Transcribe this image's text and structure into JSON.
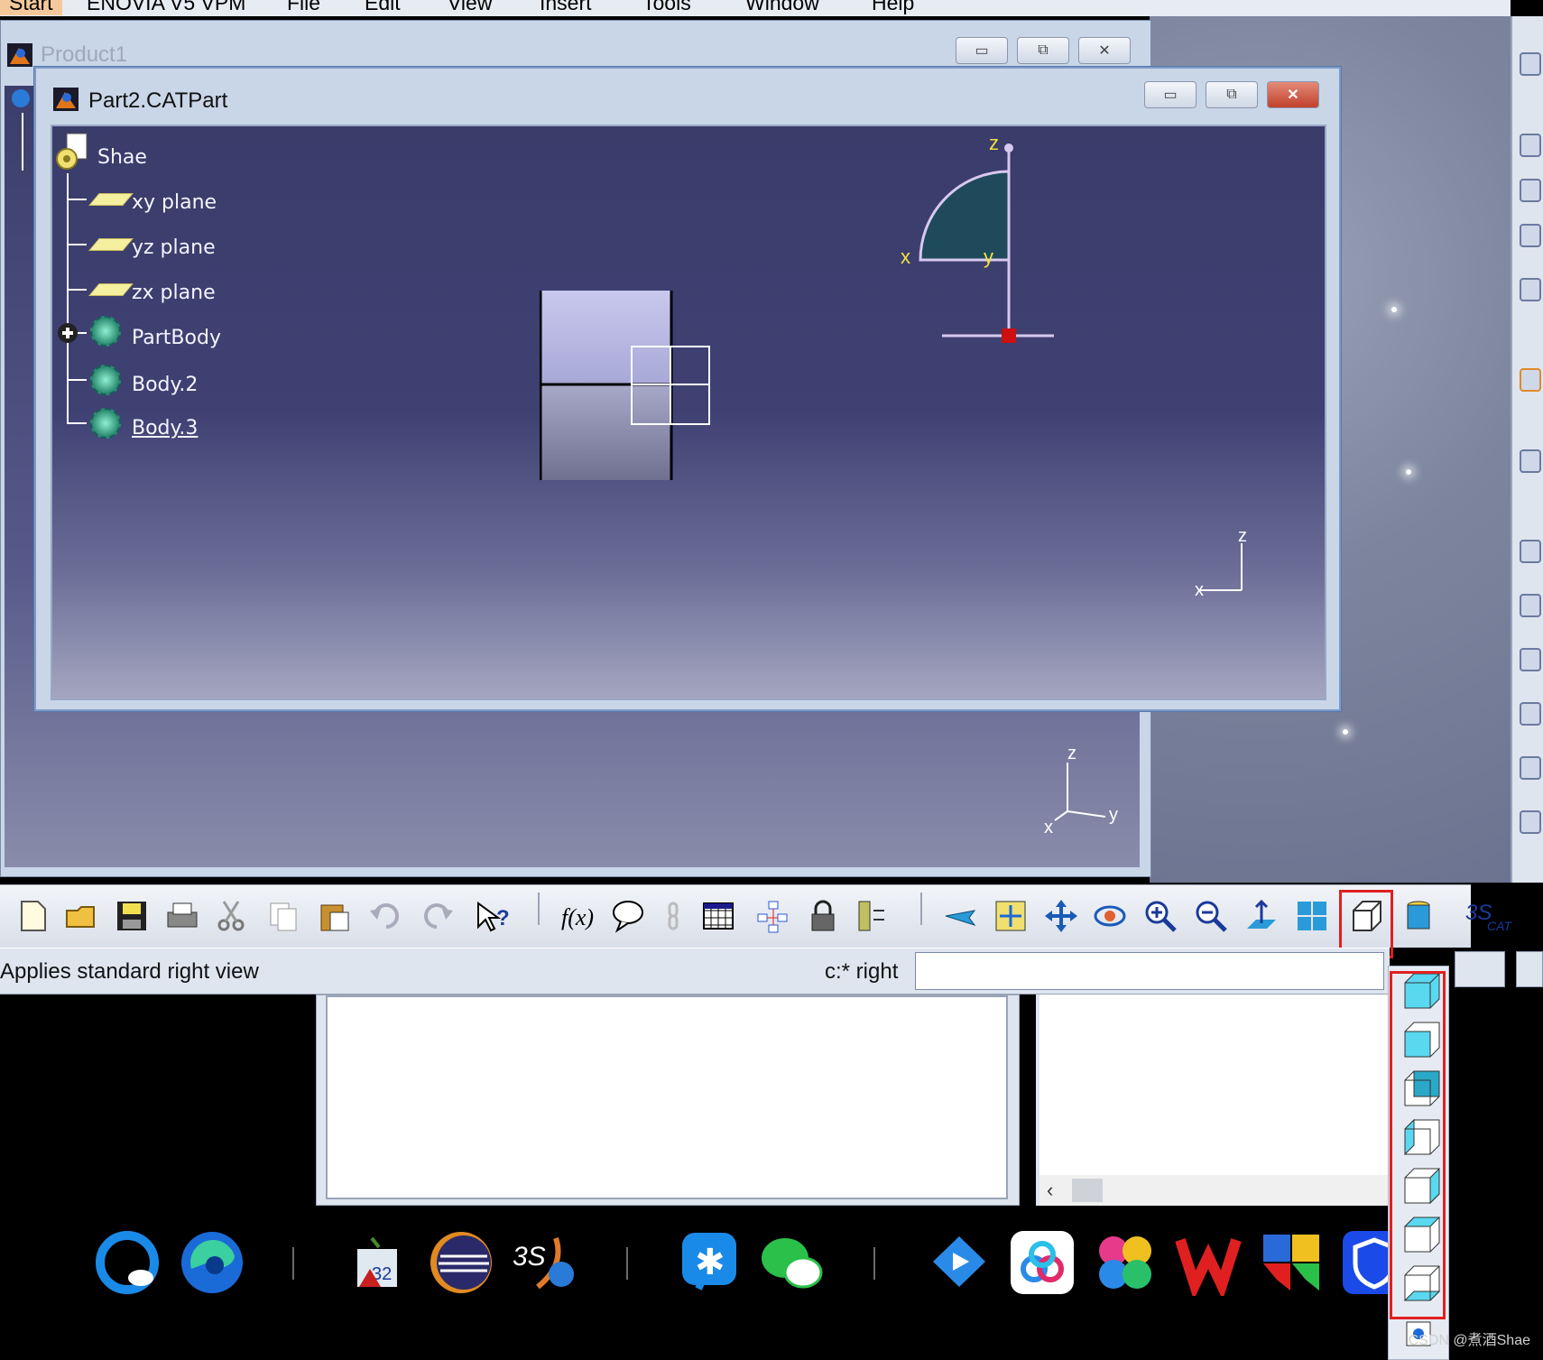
{
  "menubar": {
    "items": [
      "Start",
      "ENOVIA V5 VPM",
      "File",
      "Edit",
      "View",
      "Insert",
      "Tools",
      "Window",
      "Help"
    ]
  },
  "product_window": {
    "title": "Product1"
  },
  "part_window": {
    "title": "Part2.CATPart",
    "tree": {
      "root": "Shae",
      "items": [
        "xy plane",
        "yz plane",
        "zx plane",
        "PartBody",
        "Body.2",
        "Body.3"
      ]
    },
    "compass": {
      "z": "z",
      "x": "x",
      "y": "y"
    },
    "axis": {
      "z": "z",
      "x": "x"
    }
  },
  "product_axis": {
    "z": "z",
    "x": "x",
    "y": "y"
  },
  "window_buttons": {
    "minimize": "▭",
    "restore": "⧉",
    "close": "✕"
  },
  "statusbar": {
    "message": "Applies standard right view",
    "command_label": "c:* right",
    "command_value": ""
  },
  "watermark": "CSDN @煮酒Shae",
  "colors": {
    "canvas_top": "#3a3c6a",
    "canvas_bottom": "#a4a6c0",
    "highlight_box": "#e02020",
    "title_active": "#c9d6e8"
  },
  "toolbar": {
    "icons": [
      "new-icon",
      "open-icon",
      "save-icon",
      "print-icon",
      "cut-icon",
      "copy-icon",
      "paste-icon",
      "undo-icon",
      "redo-icon",
      "whats-this-icon",
      "formula-icon",
      "comment-icon",
      "link-icon",
      "table-icon",
      "knowledge-icon",
      "lock-icon",
      "measure-icon",
      "fly-mode-icon",
      "fit-all-icon",
      "pan-icon",
      "rotate-icon",
      "zoom-in-icon",
      "zoom-out-icon",
      "normal-view-icon",
      "multi-view-icon",
      "view-cube-icon",
      "hide-show-icon",
      "catia-logo"
    ]
  },
  "view_dropdown": {
    "items": [
      "isometric-view-icon",
      "front-view-icon",
      "back-view-icon",
      "left-view-icon",
      "right-view-icon",
      "top-view-icon",
      "bottom-view-icon"
    ]
  },
  "taskbar": {
    "icons": [
      "qq-browser-icon",
      "edge-icon",
      "catia-32-icon",
      "eclipse-icon",
      "3ds-icon",
      "dingtalk-icon",
      "wechat-icon",
      "tencent-classroom-icon",
      "baidu-netdisk-icon",
      "clover-icon",
      "wps-icon",
      "office-icon",
      "security-icon"
    ]
  }
}
